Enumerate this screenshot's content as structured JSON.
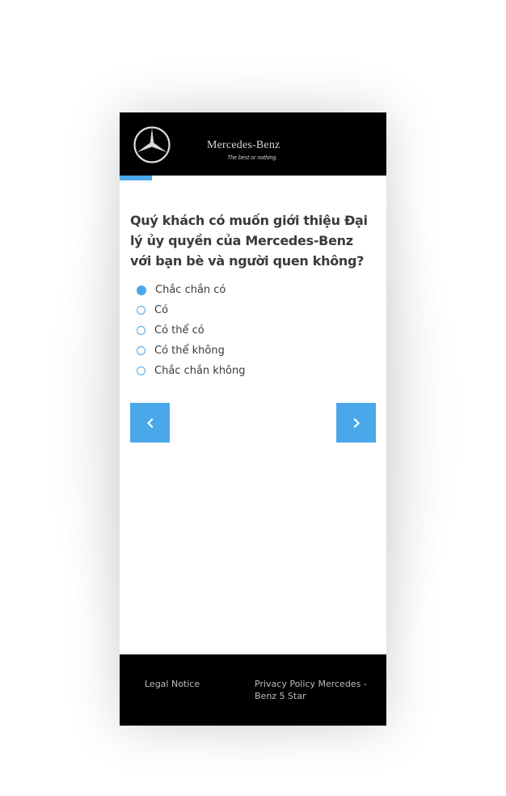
{
  "header": {
    "brand": "Mercedes-Benz",
    "slogan": "The best or nothing.",
    "logo_icon": "mercedes-star-icon"
  },
  "progress": {
    "fraction": 0.12,
    "color": "#4aa8ea"
  },
  "question": {
    "text": "Quý khách có muốn giới thiệu Đại lý ủy quyền của Mercedes-Benz với bạn bè và người quen không?",
    "options": [
      {
        "label": "Chắc chắn có",
        "selected": true
      },
      {
        "label": "Có",
        "selected": false
      },
      {
        "label": "Có thể có",
        "selected": false
      },
      {
        "label": "Có thể không",
        "selected": false
      },
      {
        "label": "Chắc chắn không",
        "selected": false
      }
    ]
  },
  "navigation": {
    "prev_icon": "chevron-left-icon",
    "next_icon": "chevron-right-icon",
    "button_color": "#4aa8ea"
  },
  "footer": {
    "legal_notice": "Legal Notice",
    "privacy_policy": "Privacy Policy Mercedes - Benz 5 Star"
  }
}
